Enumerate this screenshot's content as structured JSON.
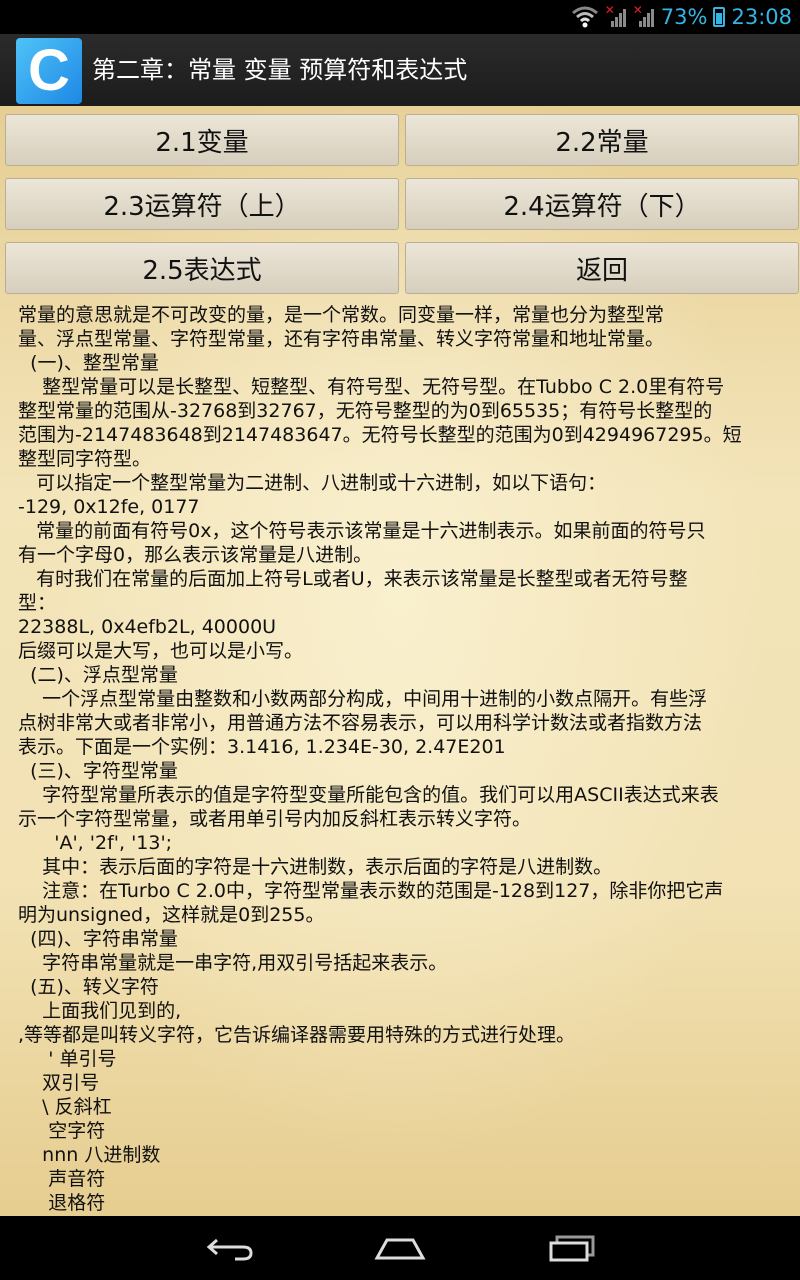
{
  "status_bar": {
    "battery": "73%",
    "time": "23:08"
  },
  "header": {
    "logo_letter": "C",
    "title": "第二章：常量 变量 预算符和表达式"
  },
  "buttons": [
    "2.1变量",
    "2.2常量",
    "2.3运算符（上）",
    "2.4运算符（下）",
    "2.5表达式",
    "返回"
  ],
  "lines": [
    "常量的意思就是不可改变的量，是一个常数。同变量一样，常量也分为整型常",
    "量、浮点型常量、字符型常量，还有字符串常量、转义字符常量和地址常量。",
    "  (一)、整型常量",
    "    整型常量可以是长整型、短整型、有符号型、无符号型。在Tubbo C 2.0里有符号",
    "整型常量的范围从-32768到32767，无符号整型的为0到65535；有符号长整型的",
    "范围为-2147483648到2147483647。无符号长整型的范围为0到4294967295。短",
    "整型同字符型。",
    "   可以指定一个整型常量为二进制、八进制或十六进制，如以下语句：",
    "-129, 0x12fe, 0177",
    "   常量的前面有符号0x，这个符号表示该常量是十六进制表示。如果前面的符号只",
    "有一个字母0，那么表示该常量是八进制。",
    "   有时我们在常量的后面加上符号L或者U，来表示该常量是长整型或者无符号整",
    "型：",
    "22388L, 0x4efb2L, 40000U",
    "后缀可以是大写，也可以是小写。",
    "  (二)、浮点型常量",
    "    一个浮点型常量由整数和小数两部分构成，中间用十进制的小数点隔开。有些浮",
    "点树非常大或者非常小，用普通方法不容易表示，可以用科学计数法或者指数方法",
    "表示。下面是一个实例：3.1416, 1.234E-30, 2.47E201",
    "  (三)、字符型常量",
    "    字符型常量所表示的值是字符型变量所能包含的值。我们可以用ASCII表达式来表",
    "示一个字符型常量，或者用单引号内加反斜杠表示转义字符。",
    "      'A', '2f', '13';",
    "    其中：表示后面的字符是十六进制数，表示后面的字符是八进制数。",
    "    注意：在Turbo C 2.0中，字符型常量表示数的范围是-128到127，除非你把它声",
    "明为unsigned，这样就是0到255。",
    "  (四)、字符串常量",
    "    字符串常量就是一串字符,用双引号括起来表示。",
    "  (五)、转义字符",
    "    上面我们见到的,",
    ",等等都是叫转义字符，它告诉编译器需要用特殊的方式进行处理。",
    "     ' 单引号",
    "    双引号",
    "    \\ 反斜杠",
    "     空字符",
    "    nnn 八进制数",
    "     声音符",
    "     退格符"
  ]
}
